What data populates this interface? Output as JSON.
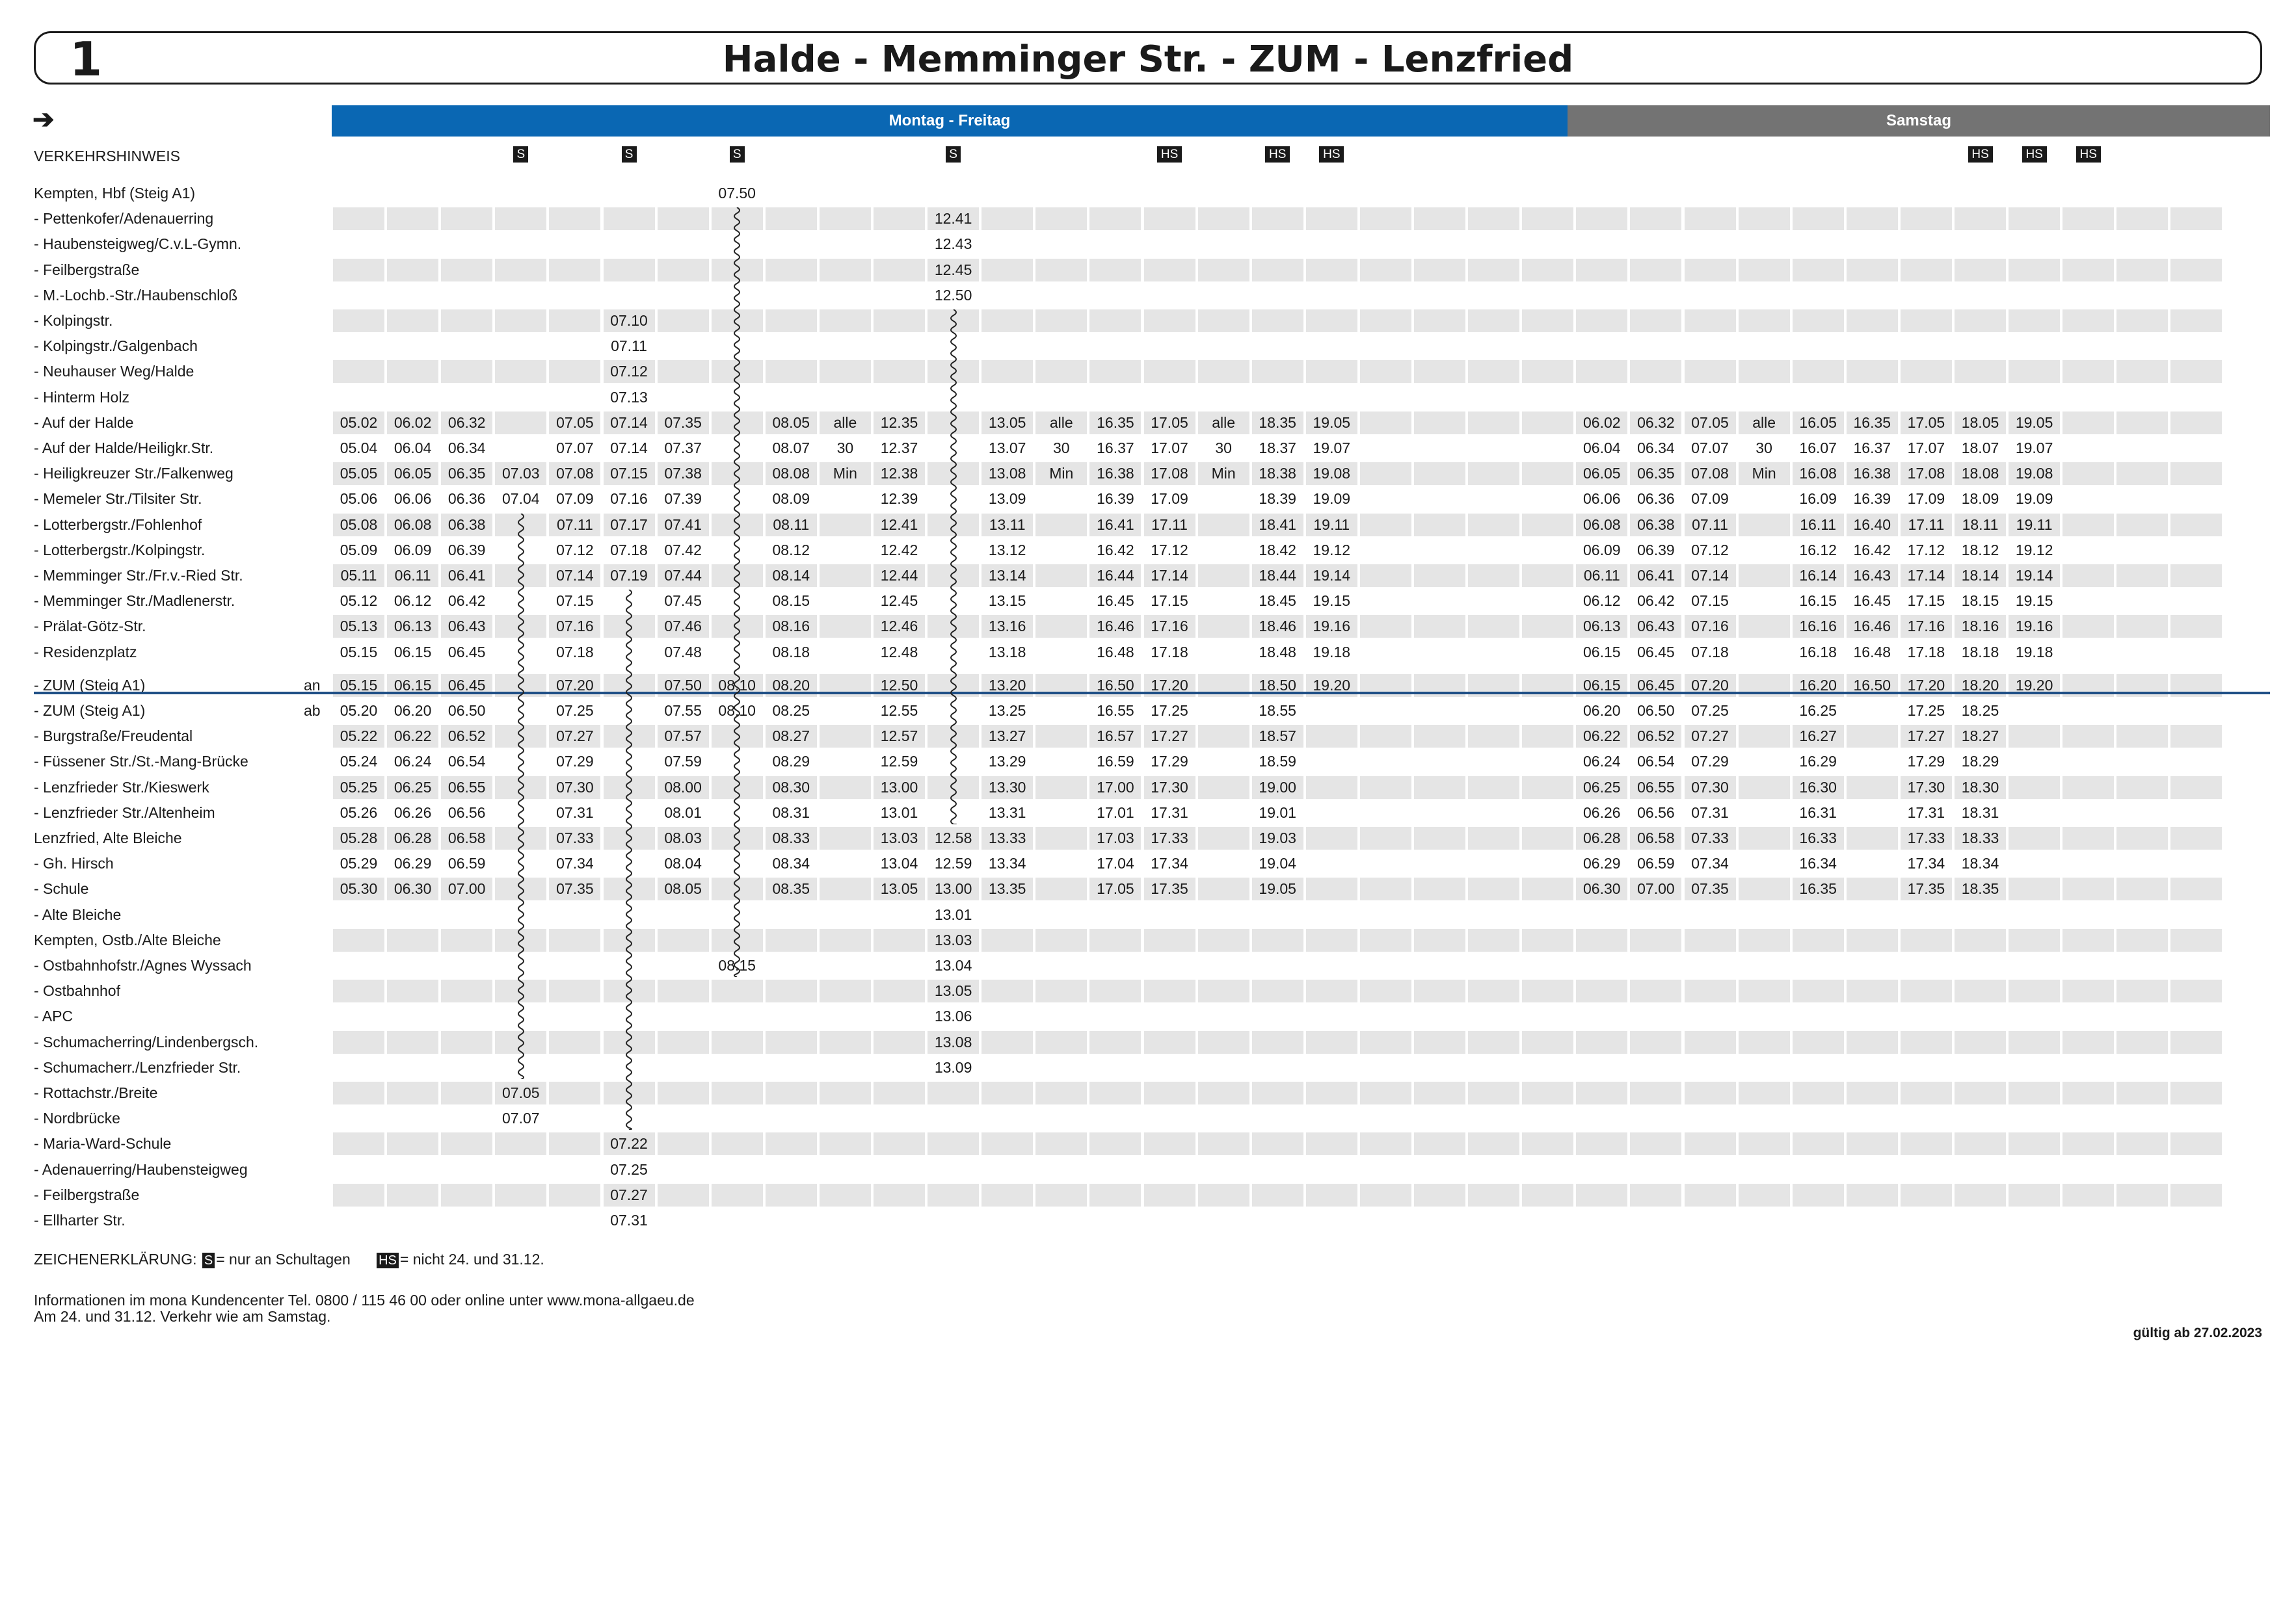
{
  "header": {
    "line": "1",
    "title": "Halde - Memminger Str. - ZUM - Lenzfried"
  },
  "arrow": "➔",
  "day_headers": {
    "mf": "Montag - Freitag",
    "sa": "Samstag"
  },
  "notice_label": "VERKEHRSHINWEIS",
  "flags": [
    "",
    "",
    "",
    "S",
    "",
    "S",
    "",
    "S",
    "",
    "",
    "",
    "S",
    "",
    "",
    "",
    "HS",
    "",
    "HS",
    "HS",
    "",
    "",
    "",
    "",
    "",
    "",
    "",
    "",
    "",
    "",
    "",
    "HS",
    "HS",
    "HS",
    "",
    "",
    ""
  ],
  "rows": [
    {
      "stop": "Kempten, Hbf (Steig A1)",
      "t": [
        "",
        "",
        "",
        "",
        "",
        "",
        "",
        "07.50"
      ]
    },
    {
      "stop": "- Pettenkofer/Adenauerring",
      "t": [
        "",
        "",
        "",
        "",
        "",
        "",
        "",
        "",
        "",
        "",
        "",
        "12.41"
      ]
    },
    {
      "stop": "- Haubensteigweg/C.v.L-Gymn.",
      "t": [
        "",
        "",
        "",
        "",
        "",
        "",
        "",
        "",
        "",
        "",
        "",
        "12.43"
      ]
    },
    {
      "stop": "- Feilbergstraße",
      "t": [
        "",
        "",
        "",
        "",
        "",
        "",
        "",
        "",
        "",
        "",
        "",
        "12.45"
      ]
    },
    {
      "stop": "- M.-Lochb.-Str./Haubenschloß",
      "t": [
        "",
        "",
        "",
        "",
        "",
        "",
        "",
        "",
        "",
        "",
        "",
        "12.50"
      ]
    },
    {
      "stop": "- Kolpingstr.",
      "t": [
        "",
        "",
        "",
        "",
        "",
        "07.10"
      ]
    },
    {
      "stop": "- Kolpingstr./Galgenbach",
      "t": [
        "",
        "",
        "",
        "",
        "",
        "07.11"
      ]
    },
    {
      "stop": "- Neuhauser Weg/Halde",
      "t": [
        "",
        "",
        "",
        "",
        "",
        "07.12"
      ]
    },
    {
      "stop": "- Hinterm Holz",
      "t": [
        "",
        "",
        "",
        "",
        "",
        "07.13"
      ]
    },
    {
      "stop": "- Auf der Halde",
      "t": [
        "05.02",
        "06.02",
        "06.32",
        "",
        "07.05",
        "07.14",
        "07.35",
        "",
        "08.05",
        "alle",
        "12.35",
        "",
        "13.05",
        "alle",
        "16.35",
        "17.05",
        "alle",
        "18.35",
        "19.05",
        "",
        "",
        "",
        "",
        "06.02",
        "06.32",
        "07.05",
        "alle",
        "16.05",
        "16.35",
        "17.05",
        "18.05",
        "19.05"
      ]
    },
    {
      "stop": "- Auf der Halde/Heiligkr.Str.",
      "t": [
        "05.04",
        "06.04",
        "06.34",
        "",
        "07.07",
        "07.14",
        "07.37",
        "",
        "08.07",
        "30",
        "12.37",
        "",
        "13.07",
        "30",
        "16.37",
        "17.07",
        "30",
        "18.37",
        "19.07",
        "",
        "",
        "",
        "",
        "06.04",
        "06.34",
        "07.07",
        "30",
        "16.07",
        "16.37",
        "17.07",
        "18.07",
        "19.07"
      ]
    },
    {
      "stop": "- Heiligkreuzer Str./Falkenweg",
      "t": [
        "05.05",
        "06.05",
        "06.35",
        "07.03",
        "07.08",
        "07.15",
        "07.38",
        "",
        "08.08",
        "Min",
        "12.38",
        "",
        "13.08",
        "Min",
        "16.38",
        "17.08",
        "Min",
        "18.38",
        "19.08",
        "",
        "",
        "",
        "",
        "06.05",
        "06.35",
        "07.08",
        "Min",
        "16.08",
        "16.38",
        "17.08",
        "18.08",
        "19.08"
      ]
    },
    {
      "stop": "- Memeler Str./Tilsiter Str.",
      "t": [
        "05.06",
        "06.06",
        "06.36",
        "07.04",
        "07.09",
        "07.16",
        "07.39",
        "",
        "08.09",
        "",
        "12.39",
        "",
        "13.09",
        "",
        "16.39",
        "17.09",
        "",
        "18.39",
        "19.09",
        "",
        "",
        "",
        "",
        "06.06",
        "06.36",
        "07.09",
        "",
        "16.09",
        "16.39",
        "17.09",
        "18.09",
        "19.09"
      ]
    },
    {
      "stop": "- Lotterbergstr./Fohlenhof",
      "t": [
        "05.08",
        "06.08",
        "06.38",
        "",
        "07.11",
        "07.17",
        "07.41",
        "",
        "08.11",
        "",
        "12.41",
        "",
        "13.11",
        "",
        "16.41",
        "17.11",
        "",
        "18.41",
        "19.11",
        "",
        "",
        "",
        "",
        "06.08",
        "06.38",
        "07.11",
        "",
        "16.11",
        "16.40",
        "17.11",
        "18.11",
        "19.11"
      ]
    },
    {
      "stop": "- Lotterbergstr./Kolpingstr.",
      "t": [
        "05.09",
        "06.09",
        "06.39",
        "",
        "07.12",
        "07.18",
        "07.42",
        "",
        "08.12",
        "",
        "12.42",
        "",
        "13.12",
        "",
        "16.42",
        "17.12",
        "",
        "18.42",
        "19.12",
        "",
        "",
        "",
        "",
        "06.09",
        "06.39",
        "07.12",
        "",
        "16.12",
        "16.42",
        "17.12",
        "18.12",
        "19.12"
      ]
    },
    {
      "stop": "- Memminger Str./Fr.v.-Ried Str.",
      "t": [
        "05.11",
        "06.11",
        "06.41",
        "",
        "07.14",
        "07.19",
        "07.44",
        "",
        "08.14",
        "",
        "12.44",
        "",
        "13.14",
        "",
        "16.44",
        "17.14",
        "",
        "18.44",
        "19.14",
        "",
        "",
        "",
        "",
        "06.11",
        "06.41",
        "07.14",
        "",
        "16.14",
        "16.43",
        "17.14",
        "18.14",
        "19.14"
      ]
    },
    {
      "stop": "- Memminger Str./Madlenerstr.",
      "t": [
        "05.12",
        "06.12",
        "06.42",
        "",
        "07.15",
        "",
        "07.45",
        "",
        "08.15",
        "",
        "12.45",
        "",
        "13.15",
        "",
        "16.45",
        "17.15",
        "",
        "18.45",
        "19.15",
        "",
        "",
        "",
        "",
        "06.12",
        "06.42",
        "07.15",
        "",
        "16.15",
        "16.45",
        "17.15",
        "18.15",
        "19.15"
      ]
    },
    {
      "stop": "- Prälat-Götz-Str.",
      "t": [
        "05.13",
        "06.13",
        "06.43",
        "",
        "07.16",
        "",
        "07.46",
        "",
        "08.16",
        "",
        "12.46",
        "",
        "13.16",
        "",
        "16.46",
        "17.16",
        "",
        "18.46",
        "19.16",
        "",
        "",
        "",
        "",
        "06.13",
        "06.43",
        "07.16",
        "",
        "16.16",
        "16.46",
        "17.16",
        "18.16",
        "19.16"
      ]
    },
    {
      "stop": "- Residenzplatz",
      "t": [
        "05.15",
        "06.15",
        "06.45",
        "",
        "07.18",
        "",
        "07.48",
        "",
        "08.18",
        "",
        "12.48",
        "",
        "13.18",
        "",
        "16.48",
        "17.18",
        "",
        "18.48",
        "19.18",
        "",
        "",
        "",
        "",
        "06.15",
        "06.45",
        "07.18",
        "",
        "16.18",
        "16.48",
        "17.18",
        "18.18",
        "19.18"
      ]
    },
    {
      "stop": "- ZUM (Steig A1)",
      "anab": "an",
      "t": [
        "05.15",
        "06.15",
        "06.45",
        "",
        "07.20",
        "",
        "07.50",
        "08.10",
        "08.20",
        "",
        "12.50",
        "",
        "13.20",
        "",
        "16.50",
        "17.20",
        "",
        "18.50",
        "19.20",
        "",
        "",
        "",
        "",
        "06.15",
        "06.45",
        "07.20",
        "",
        "16.20",
        "16.50",
        "17.20",
        "18.20",
        "19.20"
      ]
    },
    {
      "stop": "- ZUM (Steig A1)",
      "anab": "ab",
      "t": [
        "05.20",
        "06.20",
        "06.50",
        "",
        "07.25",
        "",
        "07.55",
        "08.10",
        "08.25",
        "",
        "12.55",
        "",
        "13.25",
        "",
        "16.55",
        "17.25",
        "",
        "18.55",
        "",
        "",
        "",
        "",
        "",
        "06.20",
        "06.50",
        "07.25",
        "",
        "16.25",
        "",
        "17.25",
        "18.25"
      ]
    },
    {
      "stop": "- Burgstraße/Freudental",
      "t": [
        "05.22",
        "06.22",
        "06.52",
        "",
        "07.27",
        "",
        "07.57",
        "",
        "08.27",
        "",
        "12.57",
        "",
        "13.27",
        "",
        "16.57",
        "17.27",
        "",
        "18.57",
        "",
        "",
        "",
        "",
        "",
        "06.22",
        "06.52",
        "07.27",
        "",
        "16.27",
        "",
        "17.27",
        "18.27"
      ]
    },
    {
      "stop": "- Füssener Str./St.-Mang-Brücke",
      "t": [
        "05.24",
        "06.24",
        "06.54",
        "",
        "07.29",
        "",
        "07.59",
        "",
        "08.29",
        "",
        "12.59",
        "",
        "13.29",
        "",
        "16.59",
        "17.29",
        "",
        "18.59",
        "",
        "",
        "",
        "",
        "",
        "06.24",
        "06.54",
        "07.29",
        "",
        "16.29",
        "",
        "17.29",
        "18.29"
      ]
    },
    {
      "stop": "- Lenzfrieder Str./Kieswerk",
      "t": [
        "05.25",
        "06.25",
        "06.55",
        "",
        "07.30",
        "",
        "08.00",
        "",
        "08.30",
        "",
        "13.00",
        "",
        "13.30",
        "",
        "17.00",
        "17.30",
        "",
        "19.00",
        "",
        "",
        "",
        "",
        "",
        "06.25",
        "06.55",
        "07.30",
        "",
        "16.30",
        "",
        "17.30",
        "18.30"
      ]
    },
    {
      "stop": "- Lenzfrieder Str./Altenheim",
      "t": [
        "05.26",
        "06.26",
        "06.56",
        "",
        "07.31",
        "",
        "08.01",
        "",
        "08.31",
        "",
        "13.01",
        "",
        "13.31",
        "",
        "17.01",
        "17.31",
        "",
        "19.01",
        "",
        "",
        "",
        "",
        "",
        "06.26",
        "06.56",
        "07.31",
        "",
        "16.31",
        "",
        "17.31",
        "18.31"
      ]
    },
    {
      "stop": "Lenzfried, Alte Bleiche",
      "t": [
        "05.28",
        "06.28",
        "06.58",
        "",
        "07.33",
        "",
        "08.03",
        "",
        "08.33",
        "",
        "13.03",
        "12.58",
        "13.33",
        "",
        "17.03",
        "17.33",
        "",
        "19.03",
        "",
        "",
        "",
        "",
        "",
        "06.28",
        "06.58",
        "07.33",
        "",
        "16.33",
        "",
        "17.33",
        "18.33"
      ]
    },
    {
      "stop": "- Gh. Hirsch",
      "t": [
        "05.29",
        "06.29",
        "06.59",
        "",
        "07.34",
        "",
        "08.04",
        "",
        "08.34",
        "",
        "13.04",
        "12.59",
        "13.34",
        "",
        "17.04",
        "17.34",
        "",
        "19.04",
        "",
        "",
        "",
        "",
        "",
        "06.29",
        "06.59",
        "07.34",
        "",
        "16.34",
        "",
        "17.34",
        "18.34"
      ]
    },
    {
      "stop": "- Schule",
      "t": [
        "05.30",
        "06.30",
        "07.00",
        "",
        "07.35",
        "",
        "08.05",
        "",
        "08.35",
        "",
        "13.05",
        "13.00",
        "13.35",
        "",
        "17.05",
        "17.35",
        "",
        "19.05",
        "",
        "",
        "",
        "",
        "",
        "06.30",
        "07.00",
        "07.35",
        "",
        "16.35",
        "",
        "17.35",
        "18.35"
      ]
    },
    {
      "stop": "- Alte Bleiche",
      "t": [
        "",
        "",
        "",
        "",
        "",
        "",
        "",
        "",
        "",
        "",
        "",
        "13.01"
      ]
    },
    {
      "stop": "Kempten, Ostb./Alte Bleiche",
      "t": [
        "",
        "",
        "",
        "",
        "",
        "",
        "",
        "",
        "",
        "",
        "",
        "13.03"
      ]
    },
    {
      "stop": "- Ostbahnhofstr./Agnes Wyssach",
      "t": [
        "",
        "",
        "",
        "",
        "",
        "",
        "",
        "08.15",
        "",
        "",
        "",
        "13.04"
      ]
    },
    {
      "stop": "- Ostbahnhof",
      "t": [
        "",
        "",
        "",
        "",
        "",
        "",
        "",
        "",
        "",
        "",
        "",
        "13.05"
      ]
    },
    {
      "stop": "- APC",
      "t": [
        "",
        "",
        "",
        "",
        "",
        "",
        "",
        "",
        "",
        "",
        "",
        "13.06"
      ]
    },
    {
      "stop": "- Schumacherring/Lindenbergsch.",
      "t": [
        "",
        "",
        "",
        "",
        "",
        "",
        "",
        "",
        "",
        "",
        "",
        "13.08"
      ]
    },
    {
      "stop": "- Schumacherr./Lenzfrieder Str.",
      "t": [
        "",
        "",
        "",
        "",
        "",
        "",
        "",
        "",
        "",
        "",
        "",
        "13.09"
      ]
    },
    {
      "stop": "- Rottachstr./Breite",
      "t": [
        "",
        "",
        "",
        "07.05"
      ]
    },
    {
      "stop": "- Nordbrücke",
      "t": [
        "",
        "",
        "",
        "07.07"
      ]
    },
    {
      "stop": "- Maria-Ward-Schule",
      "t": [
        "",
        "",
        "",
        "",
        "",
        "07.22"
      ]
    },
    {
      "stop": "- Adenauerring/Haubensteigweg",
      "t": [
        "",
        "",
        "",
        "",
        "",
        "07.25"
      ]
    },
    {
      "stop": "- Feilbergstraße",
      "t": [
        "",
        "",
        "",
        "",
        "",
        "07.27"
      ]
    },
    {
      "stop": "- Ellharter Str.",
      "t": [
        "",
        "",
        "",
        "",
        "",
        "07.31"
      ]
    }
  ],
  "legend": {
    "label": "ZEICHENERKLÄRUNG:",
    "s_badge": "S",
    "s_text": "= nur an Schultagen",
    "hs_badge": "HS",
    "hs_text": "= nicht 24. und 31.12."
  },
  "info": [
    "Informationen im mona Kundencenter Tel. 0800 / 115 46 00 oder online unter www.mona-allgaeu.de",
    "Am 24. und 31.12. Verkehr wie am Samstag."
  ],
  "valid": "gültig ab 27.02.2023",
  "colors": {
    "mf": "#0a67b3",
    "sa": "#737373",
    "shade": "#e5e5e5",
    "divider": "#1f4f86"
  }
}
